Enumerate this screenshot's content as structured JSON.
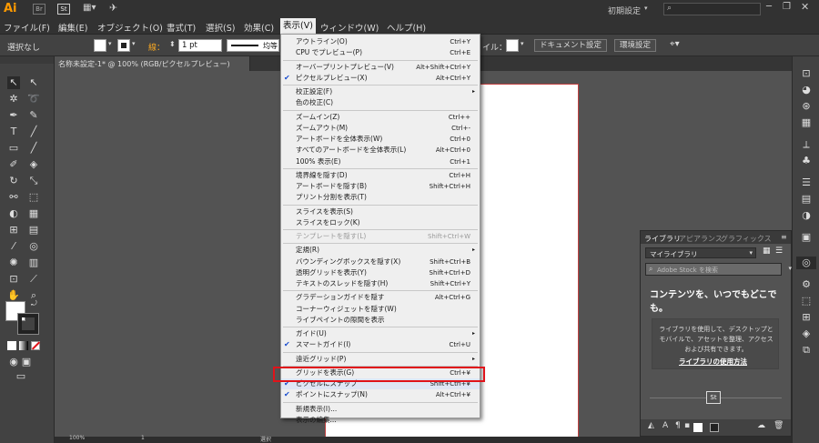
{
  "app": {
    "logo": "Ai",
    "br": "Br",
    "st": "St",
    "workspace": "初期設定",
    "search_placeholder": ""
  },
  "menubar": [
    "ファイル(F)",
    "編集(E)",
    "オブジェクト(O)",
    "書式(T)",
    "選択(S)",
    "効果(C)",
    "表示(V)",
    "ウィンドウ(W)",
    "ヘルプ(H)"
  ],
  "control": {
    "selection": "選択なし",
    "stroke_label": "線：",
    "stroke_value": "1 pt",
    "uniform": "均等",
    "style_label": "イル：",
    "doc_settings": "ドキュメント設定",
    "preferences": "環境設定"
  },
  "doc_tab": "名称未設定-1* @ 100% (RGB/ピクセルプレビュー)",
  "menu": [
    {
      "label": "アウトライン(O)",
      "shortcut": "Ctrl+Y"
    },
    {
      "label": "CPU でプレビュー(P)",
      "shortcut": "Ctrl+E"
    },
    {
      "sep": true
    },
    {
      "label": "オーバープリントプレビュー(V)",
      "shortcut": "Alt+Shift+Ctrl+Y"
    },
    {
      "label": "ピクセルプレビュー(X)",
      "shortcut": "Alt+Ctrl+Y",
      "checked": true
    },
    {
      "sep": true
    },
    {
      "label": "校正設定(F)",
      "submenu": true
    },
    {
      "label": "色の校正(C)"
    },
    {
      "sep": true
    },
    {
      "label": "ズームイン(Z)",
      "shortcut": "Ctrl++"
    },
    {
      "label": "ズームアウト(M)",
      "shortcut": "Ctrl+-"
    },
    {
      "label": "アートボードを全体表示(W)",
      "shortcut": "Ctrl+0"
    },
    {
      "label": "すべてのアートボードを全体表示(L)",
      "shortcut": "Alt+Ctrl+0"
    },
    {
      "label": "100% 表示(E)",
      "shortcut": "Ctrl+1"
    },
    {
      "sep": true
    },
    {
      "label": "境界線を隠す(D)",
      "shortcut": "Ctrl+H"
    },
    {
      "label": "アートボードを隠す(B)",
      "shortcut": "Shift+Ctrl+H"
    },
    {
      "label": "プリント分割を表示(T)"
    },
    {
      "sep": true
    },
    {
      "label": "スライスを表示(S)"
    },
    {
      "label": "スライスをロック(K)"
    },
    {
      "sep": true
    },
    {
      "label": "テンプレートを隠す(L)",
      "shortcut": "Shift+Ctrl+W",
      "disabled": true
    },
    {
      "sep": true
    },
    {
      "label": "定規(R)",
      "submenu": true
    },
    {
      "label": "バウンディングボックスを隠す(X)",
      "shortcut": "Shift+Ctrl+B"
    },
    {
      "label": "透明グリッドを表示(Y)",
      "shortcut": "Shift+Ctrl+D"
    },
    {
      "label": "テキストのスレッドを隠す(H)",
      "shortcut": "Shift+Ctrl+Y"
    },
    {
      "sep": true
    },
    {
      "label": "グラデーションガイドを隠す",
      "shortcut": "Alt+Ctrl+G"
    },
    {
      "label": "コーナーウィジェットを隠す(W)"
    },
    {
      "label": "ライブペイントの隙間を表示"
    },
    {
      "sep": true
    },
    {
      "label": "ガイド(U)",
      "submenu": true
    },
    {
      "label": "スマートガイド(I)",
      "shortcut": "Ctrl+U",
      "checked": true
    },
    {
      "sep": true
    },
    {
      "label": "遠近グリッド(P)",
      "submenu": true
    },
    {
      "sep": true
    },
    {
      "label": "グリッドを表示(G)",
      "shortcut": "Ctrl+¥"
    },
    {
      "label": "ピクセルにスナップ",
      "shortcut": "Shift+Ctrl+¥",
      "checked": true,
      "highlight": true
    },
    {
      "label": "ポイントにスナップ(N)",
      "shortcut": "Alt+Ctrl+¥",
      "checked": true
    },
    {
      "sep": true
    },
    {
      "label": "新規表示(I)..."
    },
    {
      "label": "表示の編集..."
    }
  ],
  "library": {
    "tabs": [
      "ライブラリ",
      "アピアランス",
      "グラフィックス"
    ],
    "dropdown": "マイライブラリ",
    "search_placeholder": "Adobe Stock を検索",
    "headline": "コンテンツを、いつでもどこでも。",
    "body": "ライブラリを使用して、デスクトップとモバイルで、アセットを整理、アクセスおよび共有できます。",
    "link": "ライブラリの使用方法",
    "st_badge": "St"
  },
  "status": {
    "zoom": "100%",
    "page": "1",
    "mode": "選択"
  },
  "colors": {
    "highlight": "#e0131a",
    "check": "#1a4ecf"
  }
}
